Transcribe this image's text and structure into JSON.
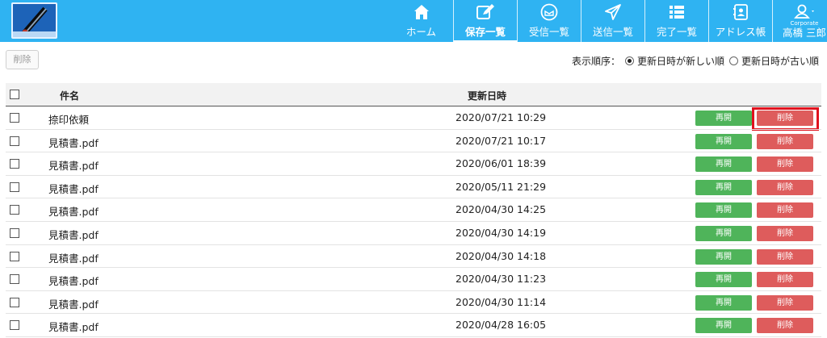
{
  "brand": {
    "logo_icon": "app-logo-icon"
  },
  "nav": [
    {
      "icon": "home-icon",
      "label": "ホーム",
      "active": false
    },
    {
      "icon": "edit-icon",
      "label": "保存一覧",
      "active": true
    },
    {
      "icon": "inbox-icon",
      "label": "受信一覧",
      "active": false
    },
    {
      "icon": "send-icon",
      "label": "送信一覧",
      "active": false
    },
    {
      "icon": "list-icon",
      "label": "完了一覧",
      "active": false
    },
    {
      "icon": "address-book-icon",
      "label": "アドレス帳",
      "active": false
    }
  ],
  "user": {
    "icon": "user-icon",
    "tag": "Corporate",
    "name": "高橋 三郎"
  },
  "toolbar": {
    "delete_label": "削除",
    "sort_label": "表示順序：",
    "sort_options": [
      {
        "label": "更新日時が新しい順",
        "checked": true
      },
      {
        "label": "更新日時が古い順",
        "checked": false
      }
    ]
  },
  "table": {
    "headers": {
      "name": "件名",
      "date": "更新日時"
    },
    "resume_label": "再開",
    "delete_label": "削除",
    "rows": [
      {
        "name": "捺印依頼",
        "date": "2020/07/21 10:29"
      },
      {
        "name": "見積書.pdf",
        "date": "2020/07/21 10:17"
      },
      {
        "name": "見積書.pdf",
        "date": "2020/06/01 18:39"
      },
      {
        "name": "見積書.pdf",
        "date": "2020/05/11 21:29"
      },
      {
        "name": "見積書.pdf",
        "date": "2020/04/30 14:25"
      },
      {
        "name": "見積書.pdf",
        "date": "2020/04/30 14:19"
      },
      {
        "name": "見積書.pdf",
        "date": "2020/04/30 14:18"
      },
      {
        "name": "見積書.pdf",
        "date": "2020/04/30 11:23"
      },
      {
        "name": "見積書.pdf",
        "date": "2020/04/30 11:14"
      },
      {
        "name": "見積書.pdf",
        "date": "2020/04/28 16:05"
      }
    ]
  },
  "colors": {
    "header": "#2fb3f2",
    "resume": "#4fb45a",
    "delete": "#de5c5c",
    "highlight": "#e0121e"
  }
}
